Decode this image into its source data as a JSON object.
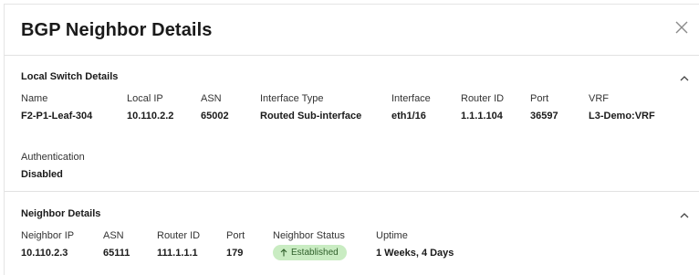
{
  "modal": {
    "title": "BGP Neighbor Details"
  },
  "local_switch": {
    "heading": "Local Switch Details",
    "fields": [
      {
        "label": "Name",
        "value": "F2-P1-Leaf-304"
      },
      {
        "label": "Local IP",
        "value": "10.110.2.2"
      },
      {
        "label": "ASN",
        "value": "65002"
      },
      {
        "label": "Interface Type",
        "value": "Routed Sub-interface"
      },
      {
        "label": "Interface",
        "value": "eth1/16"
      },
      {
        "label": "Router ID",
        "value": "1.1.1.104"
      },
      {
        "label": "Port",
        "value": "36597"
      },
      {
        "label": "VRF",
        "value": "L3-Demo:VRF"
      },
      {
        "label": "Authentication",
        "value": "Disabled"
      }
    ]
  },
  "neighbor": {
    "heading": "Neighbor Details",
    "fields": [
      {
        "label": "Neighbor IP",
        "value": "10.110.2.3"
      },
      {
        "label": "ASN",
        "value": "65111"
      },
      {
        "label": "Router ID",
        "value": "111.1.1.1"
      },
      {
        "label": "Port",
        "value": "179"
      },
      {
        "label": "Neighbor Status",
        "value": "Established"
      },
      {
        "label": "Uptime",
        "value": "1 Weeks, 4 Days"
      }
    ],
    "status_color": "#c9ecc2",
    "status_icon": "arrow-up-icon"
  },
  "icons": {
    "close": "close-icon",
    "collapse": "chevron-up-icon"
  }
}
